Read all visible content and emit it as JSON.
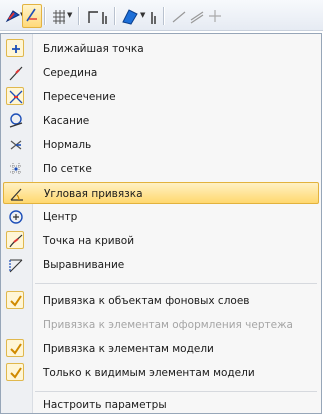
{
  "toolbar": {
    "icons": [
      "snap-mode-icon",
      "snap-local-icon",
      "grid-icon",
      "ortho-icon",
      "fill-color-icon",
      "line-style-icon",
      "hatch-icon",
      "dimension-icon"
    ]
  },
  "menu": {
    "items": [
      {
        "label": "Ближайшая точка",
        "accel": "Б",
        "icon": "nearest-point-icon"
      },
      {
        "label": "Середина",
        "accel": "С",
        "icon": "midpoint-icon"
      },
      {
        "label": "Пересечение",
        "accel": "П",
        "icon": "intersection-icon",
        "checked": true
      },
      {
        "label": "Касание",
        "accel": "К",
        "icon": "tangent-icon"
      },
      {
        "label": "Нормаль",
        "accel": "Н",
        "icon": "normal-icon"
      },
      {
        "label": "По сетке",
        "accel": "с",
        "icon": "grid-snap-icon"
      },
      {
        "label": "Угловая привязка",
        "accel": "У",
        "icon": "angle-snap-icon",
        "highlighted": true
      },
      {
        "label": "Центр",
        "accel": "Ц",
        "icon": "center-icon"
      },
      {
        "label": "Точка на кривой",
        "accel": "Т",
        "icon": "point-on-curve-icon",
        "checked": true
      },
      {
        "label": "Выравнивание",
        "accel": "В",
        "icon": "alignment-icon"
      }
    ],
    "options": [
      {
        "label": "Привязка к объектам фоновых слоев",
        "checked": true,
        "enabled": true
      },
      {
        "label": "Привязка к элементам оформления чертежа",
        "checked": false,
        "enabled": false
      },
      {
        "label": "Привязка к элементам модели",
        "checked": true,
        "enabled": true
      },
      {
        "label": "Только к видимым элементам модели",
        "checked": true,
        "enabled": true
      }
    ],
    "settings_label": "Настроить параметры"
  },
  "colors": {
    "highlight": "#ffd86f",
    "check_border": "#e0b84d",
    "check_mark": "#d08a00",
    "icon_blue": "#1d4fb8"
  }
}
